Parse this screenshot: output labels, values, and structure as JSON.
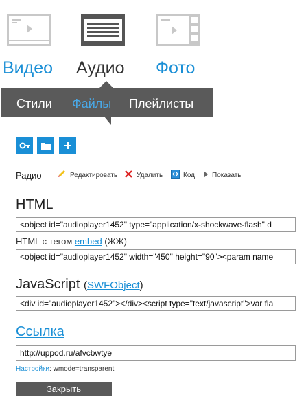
{
  "media_tabs": [
    {
      "label": "Видео",
      "icon": "video-icon",
      "active": false
    },
    {
      "label": "Аудио",
      "icon": "audio-icon",
      "active": true
    },
    {
      "label": "Фото",
      "icon": "photo-icon",
      "active": false
    }
  ],
  "subnav": {
    "tabs": [
      {
        "label": "Стили",
        "active": false
      },
      {
        "label": "Файлы",
        "active": true
      },
      {
        "label": "Плейлисты",
        "active": false
      }
    ]
  },
  "toolbar": {
    "buttons": [
      "key-icon",
      "folder-icon",
      "plus-icon"
    ]
  },
  "item": {
    "name": "Радио",
    "actions": {
      "edit": "Редактировать",
      "delete": "Удалить",
      "code": "Код",
      "show": "Показать"
    }
  },
  "html_section": {
    "heading": "HTML",
    "code": "<object id=\"audioplayer1452\" type=\"application/x-shockwave-flash\" d",
    "embed_prefix": "HTML с тегом",
    "embed_link": "embed",
    "embed_suffix": "(ЖЖ)",
    "embed_code": "<object id=\"audioplayer1452\" width=\"450\" height=\"90\"><param name"
  },
  "js_section": {
    "heading": "JavaScript",
    "paren_open": "(",
    "link": "SWFObject",
    "paren_close": ")",
    "code": "<div id=\"audioplayer1452\"></div><script type=\"text/javascript\">var fla"
  },
  "link_section": {
    "heading": "Ссылка",
    "url": "http://uppod.ru/afvcbwtye"
  },
  "settings": {
    "link": "Настройки",
    "text": ": wmode=transparent"
  },
  "close_label": "Закрыть",
  "colors": {
    "accent": "#1a8fd6",
    "dark_bar": "#5a5a5a"
  }
}
